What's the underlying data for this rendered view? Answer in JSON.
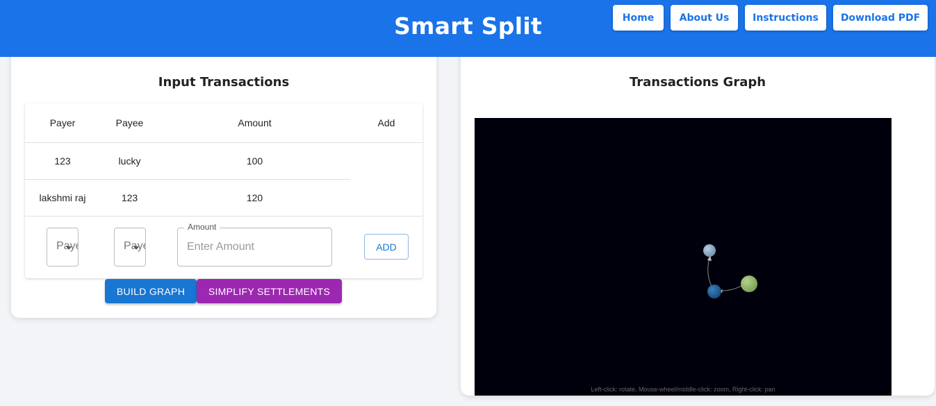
{
  "header": {
    "title": "Smart Split",
    "nav": [
      {
        "label": "Home"
      },
      {
        "label": "About Us"
      },
      {
        "label": "Instructions"
      },
      {
        "label": "Download PDF"
      }
    ]
  },
  "colors": {
    "header_bg": "#1a73e8",
    "build_button": "#1976d2",
    "simplify_button": "#9c27b0",
    "graph_bg": "#00000c"
  },
  "input_panel": {
    "title": "Input Transactions",
    "columns": [
      "Payer",
      "Payee",
      "Amount",
      "Add"
    ],
    "rows": [
      {
        "payer": "123",
        "payee": "lucky",
        "amount": "100"
      },
      {
        "payer": "lakshmi raj",
        "payee": "123",
        "amount": "120"
      }
    ],
    "form": {
      "payer_placeholder": "Payer",
      "payee_placeholder": "Payee",
      "amount_label": "Amount",
      "amount_placeholder": "Enter Amount",
      "add_label": "ADD"
    },
    "build_label": "BUILD GRAPH",
    "simplify_label": "SIMPLIFY SETTLEMENTS"
  },
  "graph_panel": {
    "title": "Transactions Graph",
    "hint": "Left-click: rotate, Mouse-wheel/middle-click: zoom, Right-click: pan",
    "nodes": [
      {
        "id": "node-a",
        "color": "#7f9fbf"
      },
      {
        "id": "node-b",
        "color": "#1f5f9a"
      },
      {
        "id": "node-c",
        "color": "#8fb56a"
      }
    ]
  }
}
